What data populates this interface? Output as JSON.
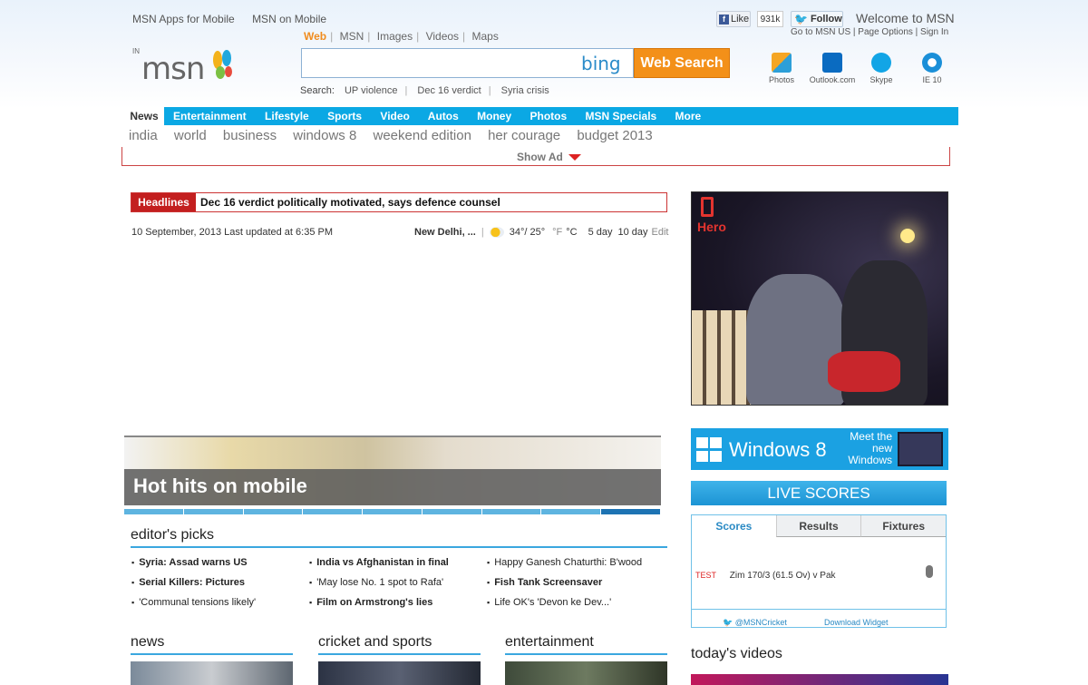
{
  "top": {
    "apps_link": "MSN Apps for Mobile",
    "mobile_link": "MSN on Mobile",
    "fb_like": "Like",
    "like_count": "931k",
    "twitter_follow": "Follow",
    "welcome": "Welcome to MSN",
    "account_links": "Go to MSN US | Page Options | Sign In"
  },
  "logo": {
    "region": "IN",
    "text": "msn"
  },
  "search": {
    "tabs": [
      "Web",
      "MSN",
      "Images",
      "Videos",
      "Maps"
    ],
    "bing": "bing",
    "button": "Web Search",
    "trending_label": "Search:",
    "trending": [
      "UP violence",
      "Dec 16 verdict",
      "Syria crisis"
    ]
  },
  "apps": [
    "Photos",
    "Outlook.com",
    "Skype",
    "IE 10"
  ],
  "nav": {
    "active": "News",
    "items": [
      "Entertainment",
      "Lifestyle",
      "Sports",
      "Video",
      "Autos",
      "Money",
      "Photos",
      "MSN Specials",
      "More"
    ]
  },
  "subnav": [
    "india",
    "world",
    "business",
    "windows 8",
    "weekend edition",
    "her courage",
    "budget 2013"
  ],
  "show_ad": "Show Ad",
  "headline": {
    "tag": "Headlines",
    "text": "Dec 16 verdict politically motivated, says defence counsel"
  },
  "dateline": "10 September, 2013  Last updated at 6:35 PM",
  "weather": {
    "city": "New Delhi, ...",
    "temp": "34°/ 25°",
    "f": "°F",
    "c": "°C",
    "five": "5 day",
    "ten": "10 day",
    "edit": "Edit"
  },
  "slideshow": {
    "title": "Hot hits on mobile"
  },
  "editors_picks": {
    "title": "editor's picks",
    "col1": [
      {
        "text": "Syria: Assad warns US",
        "bold": true
      },
      {
        "text": "Serial Killers: Pictures",
        "bold": true
      },
      {
        "text": "'Communal tensions likely'",
        "bold": false
      }
    ],
    "col2": [
      {
        "text": "India vs Afghanistan in final",
        "bold": true
      },
      {
        "text": "'May lose No. 1 spot to Rafa'",
        "bold": false
      },
      {
        "text": "Film on Armstrong's lies",
        "bold": true
      }
    ],
    "col3": [
      {
        "text": "Happy Ganesh Chaturthi: B'wood",
        "bold": false
      },
      {
        "text": "Fish Tank Screensaver",
        "bold": true
      },
      {
        "text": "Life OK's 'Devon ke Dev...'",
        "bold": false
      }
    ]
  },
  "sections": [
    "news",
    "cricket and sports",
    "entertainment"
  ],
  "ad": {
    "brand": "Hero"
  },
  "win8": {
    "title": "Windows 8",
    "tagline": "Meet the new Windows"
  },
  "live_scores": {
    "title": "LIVE SCORES",
    "tabs": [
      "Scores",
      "Results",
      "Fixtures"
    ],
    "match_type": "TEST",
    "match": "Zim 170/3 (61.5 Ov)   v   Pak",
    "twitter": "@MSNCricket",
    "download": "Download Widget"
  },
  "todays_videos": "today's videos"
}
